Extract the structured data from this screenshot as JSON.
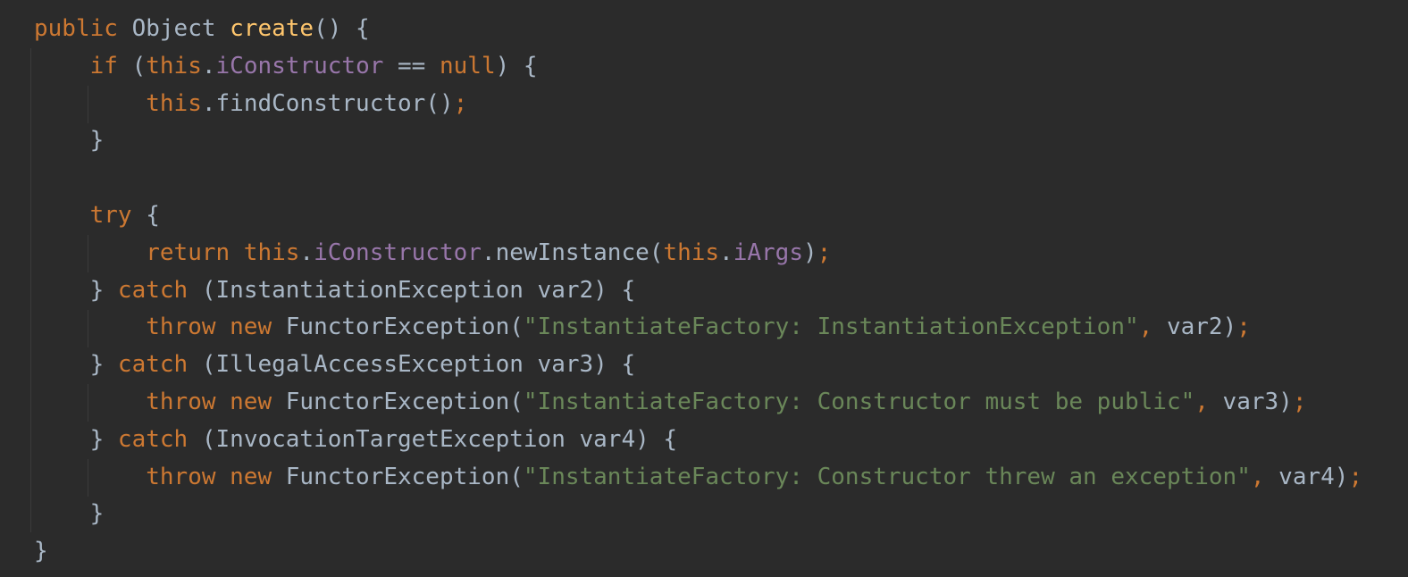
{
  "editor": {
    "lines": [
      [
        {
          "t": "public",
          "c": "kw"
        },
        {
          "t": " Object ",
          "c": "pl"
        },
        {
          "t": "create",
          "c": "fn"
        },
        {
          "t": "() {",
          "c": "pl"
        }
      ],
      [
        {
          "t": "    ",
          "c": "pl"
        },
        {
          "t": "if",
          "c": "kw"
        },
        {
          "t": " (",
          "c": "pl"
        },
        {
          "t": "this",
          "c": "kw"
        },
        {
          "t": ".",
          "c": "pl"
        },
        {
          "t": "iConstructor",
          "c": "fld"
        },
        {
          "t": " == ",
          "c": "pl"
        },
        {
          "t": "null",
          "c": "kw"
        },
        {
          "t": ") {",
          "c": "pl"
        }
      ],
      [
        {
          "t": "        ",
          "c": "pl"
        },
        {
          "t": "this",
          "c": "kw"
        },
        {
          "t": ".findConstructor()",
          "c": "pl"
        },
        {
          "t": ";",
          "c": "semi"
        }
      ],
      [
        {
          "t": "    }",
          "c": "pl"
        }
      ],
      [],
      [
        {
          "t": "    ",
          "c": "pl"
        },
        {
          "t": "try",
          "c": "kw"
        },
        {
          "t": " {",
          "c": "pl"
        }
      ],
      [
        {
          "t": "        ",
          "c": "pl"
        },
        {
          "t": "return this",
          "c": "kw"
        },
        {
          "t": ".",
          "c": "pl"
        },
        {
          "t": "iConstructor",
          "c": "fld"
        },
        {
          "t": ".newInstance(",
          "c": "pl"
        },
        {
          "t": "this",
          "c": "kw"
        },
        {
          "t": ".",
          "c": "pl"
        },
        {
          "t": "iArgs",
          "c": "fld"
        },
        {
          "t": ")",
          "c": "pl"
        },
        {
          "t": ";",
          "c": "semi"
        }
      ],
      [
        {
          "t": "    } ",
          "c": "pl"
        },
        {
          "t": "catch",
          "c": "kw"
        },
        {
          "t": " (InstantiationException var2) {",
          "c": "pl"
        }
      ],
      [
        {
          "t": "        ",
          "c": "pl"
        },
        {
          "t": "throw new",
          "c": "kw"
        },
        {
          "t": " FunctorException(",
          "c": "pl"
        },
        {
          "t": "\"InstantiateFactory: InstantiationException\"",
          "c": "str"
        },
        {
          "t": ",",
          "c": "semi"
        },
        {
          "t": " var2)",
          "c": "pl"
        },
        {
          "t": ";",
          "c": "semi"
        }
      ],
      [
        {
          "t": "    } ",
          "c": "pl"
        },
        {
          "t": "catch",
          "c": "kw"
        },
        {
          "t": " (IllegalAccessException var3) {",
          "c": "pl"
        }
      ],
      [
        {
          "t": "        ",
          "c": "pl"
        },
        {
          "t": "throw new",
          "c": "kw"
        },
        {
          "t": " FunctorException(",
          "c": "pl"
        },
        {
          "t": "\"InstantiateFactory: Constructor must be public\"",
          "c": "str"
        },
        {
          "t": ",",
          "c": "semi"
        },
        {
          "t": " var3)",
          "c": "pl"
        },
        {
          "t": ";",
          "c": "semi"
        }
      ],
      [
        {
          "t": "    } ",
          "c": "pl"
        },
        {
          "t": "catch",
          "c": "kw"
        },
        {
          "t": " (InvocationTargetException var4) {",
          "c": "pl"
        }
      ],
      [
        {
          "t": "        ",
          "c": "pl"
        },
        {
          "t": "throw new",
          "c": "kw"
        },
        {
          "t": " FunctorException(",
          "c": "pl"
        },
        {
          "t": "\"InstantiateFactory: Constructor threw an exception\"",
          "c": "str"
        },
        {
          "t": ",",
          "c": "semi"
        },
        {
          "t": " var4)",
          "c": "pl"
        },
        {
          "t": ";",
          "c": "semi"
        }
      ],
      [
        {
          "t": "    }",
          "c": "pl"
        }
      ],
      [
        {
          "t": "}",
          "c": "pl"
        }
      ]
    ]
  },
  "colors": {
    "background": "#2b2b2b",
    "keyword": "#cc7832",
    "method": "#ffc66d",
    "field": "#9876aa",
    "string": "#6a8759",
    "plain": "#a9b7c6",
    "indent_guide": "#3b3b3b"
  }
}
